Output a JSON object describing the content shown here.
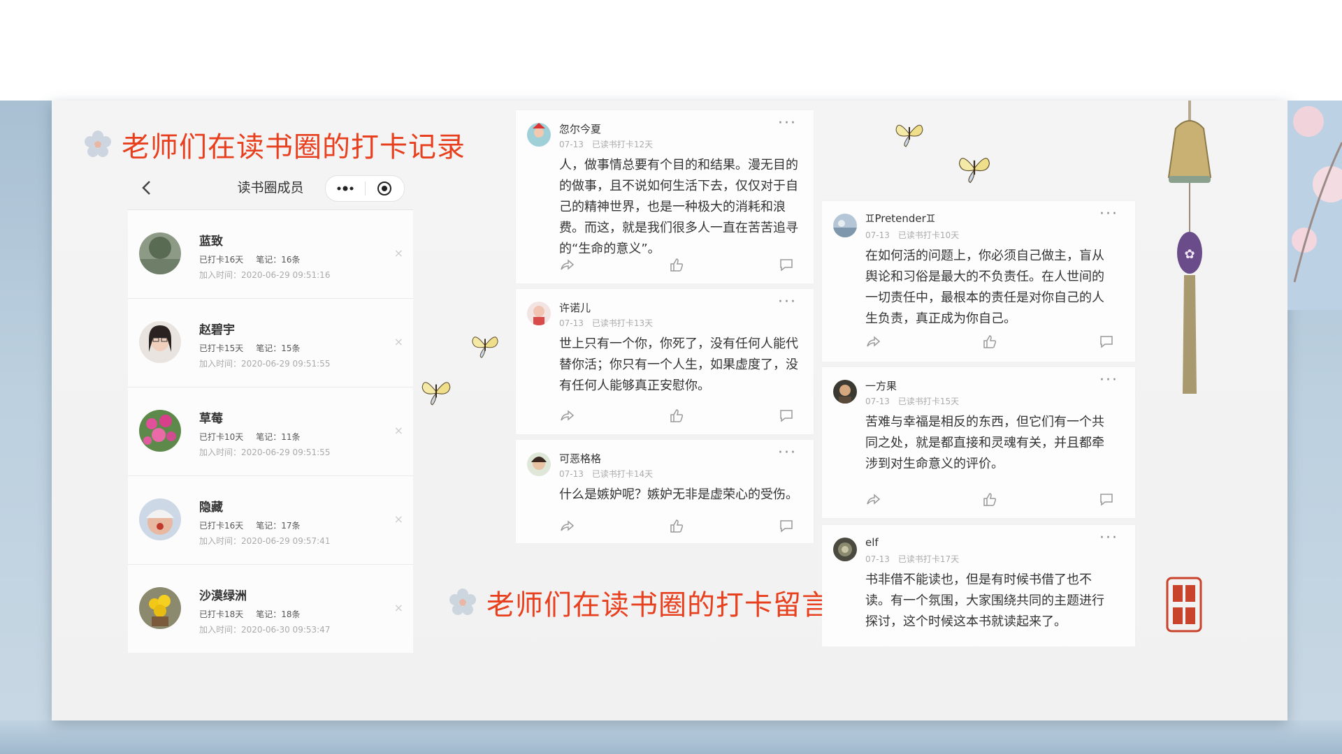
{
  "headings": {
    "records": "老师们在读书圈的打卡记录",
    "comments": "老师们在读书圈的打卡留言"
  },
  "phone": {
    "title": "读书圈成员",
    "members": [
      {
        "name": "蓝致",
        "checkin": "已打卡16天",
        "notes": "笔记：16条",
        "joined": "加入时间：2020-06-29 09:51:16",
        "remove": "×"
      },
      {
        "name": "赵碧宇",
        "checkin": "已打卡15天",
        "notes": "笔记：15条",
        "joined": "加入时间：2020-06-29 09:51:55",
        "remove": "×"
      },
      {
        "name": "草莓",
        "checkin": "已打卡10天",
        "notes": "笔记：11条",
        "joined": "加入时间：2020-06-29 09:51:55",
        "remove": "×"
      },
      {
        "name": "隐藏",
        "checkin": "已打卡16天",
        "notes": "笔记：17条",
        "joined": "加入时间：2020-06-29 09:57:41",
        "remove": "×"
      },
      {
        "name": "沙漠绿洲",
        "checkin": "已打卡18天",
        "notes": "笔记：18条",
        "joined": "加入时间：2020-06-30 09:53:47",
        "remove": "×"
      }
    ]
  },
  "posts": [
    {
      "name": "忽尔今夏",
      "date": "07-13",
      "status": "已读书打卡12天",
      "more": "···",
      "lines": [
        "人，做事情总要有个目的和结果。漫无目的",
        "的做事，且不说如何生活下去，仅仅对于自",
        "己的精神世界，也是一种极大的消耗和浪",
        "费。而这，就是我们很多人一直在苦苦追寻",
        "的“生命的意义”。"
      ]
    },
    {
      "name": "许诺儿",
      "date": "07-13",
      "status": "已读书打卡13天",
      "more": "···",
      "lines": [
        "世上只有一个你，你死了，没有任何人能代",
        "替你活；你只有一个人生，如果虚度了，没",
        "有任何人能够真正安慰你。"
      ]
    },
    {
      "name": "可恶格格",
      "date": "07-13",
      "status": "已读书打卡14天",
      "more": "···",
      "lines": [
        "什么是嫉妒呢？嫉妒无非是虚荣心的受伤。"
      ]
    },
    {
      "name": "♊Pretender♊",
      "date": "07-13",
      "status": "已读书打卡10天",
      "more": "···",
      "lines": [
        "在如何活的问题上，你必须自己做主，盲从",
        "舆论和习俗是最大的不负责任。在人世间的",
        "一切责任中，最根本的责任是对你自己的人",
        "生负责，真正成为你自己。"
      ]
    },
    {
      "name": "一方果",
      "date": "07-13",
      "status": "已读书打卡15天",
      "more": "···",
      "lines": [
        "苦难与幸福是相反的东西，但它们有一个共",
        "同之处，就是都直接和灵魂有关，并且都牵",
        "涉到对生命意义的评价。"
      ]
    },
    {
      "name": "elf",
      "date": "07-13",
      "status": "已读书打卡17天",
      "more": "···",
      "lines": [
        "书非借不能读也，但是有时候书借了也不",
        "读。有一个氛围，大家围绕共同的主题进行",
        "探讨，这个时候这本书就读起来了。"
      ]
    }
  ],
  "colors": {
    "heading": "#e8401e",
    "stamp": "#c9432c"
  },
  "icons": [
    "back-icon",
    "more-dots-icon",
    "target-icon",
    "share-icon",
    "thumb-up-icon",
    "comment-icon",
    "flower-icon",
    "butterfly-icon",
    "wind-chime",
    "seal-stamp"
  ]
}
